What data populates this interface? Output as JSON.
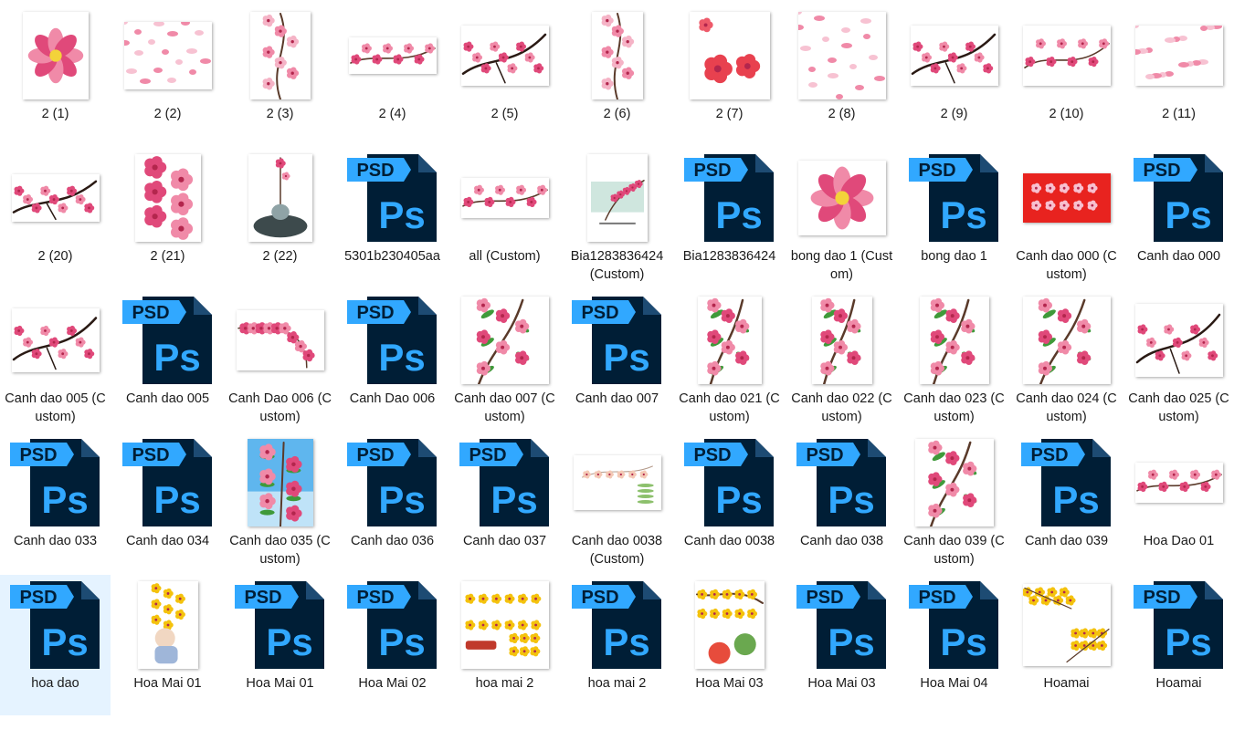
{
  "window": {
    "title": ""
  },
  "items": [
    {
      "name": "2 (1)",
      "kind": "img",
      "art": "flower-big",
      "bg": "#ffffff",
      "w": 72,
      "h": 96
    },
    {
      "name": "2 (2)",
      "kind": "img",
      "art": "petals",
      "bg": "#ffffff",
      "w": 96,
      "h": 74
    },
    {
      "name": "2 (3)",
      "kind": "img",
      "art": "branch-v",
      "bg": "#ffffff",
      "w": 66,
      "h": 96
    },
    {
      "name": "2 (4)",
      "kind": "img",
      "art": "branch-h",
      "bg": "#ffffff",
      "w": 96,
      "h": 40
    },
    {
      "name": "2 (5)",
      "kind": "img",
      "art": "branch-dark",
      "bg": "#ffffff",
      "w": 96,
      "h": 66
    },
    {
      "name": "2 (6)",
      "kind": "img",
      "art": "branch-v",
      "bg": "#ffffff",
      "w": 56,
      "h": 96
    },
    {
      "name": "2 (7)",
      "kind": "img",
      "art": "poppies",
      "bg": "#ffffff",
      "w": 88,
      "h": 96
    },
    {
      "name": "2 (8)",
      "kind": "img",
      "art": "petals",
      "bg": "#ffffff",
      "w": 96,
      "h": 96
    },
    {
      "name": "2 (9)",
      "kind": "img",
      "art": "branch-dark",
      "bg": "#ffffff",
      "w": 96,
      "h": 66
    },
    {
      "name": "2 (10)",
      "kind": "img",
      "art": "branch-h",
      "bg": "#ffffff",
      "w": 96,
      "h": 66
    },
    {
      "name": "2 (11)",
      "kind": "img",
      "art": "petals",
      "bg": "#ffffff",
      "w": 96,
      "h": 66
    },
    {
      "name": "2 (20)",
      "kind": "img",
      "art": "branch-dark",
      "bg": "#ffffff",
      "w": 96,
      "h": 52
    },
    {
      "name": "2 (21)",
      "kind": "img",
      "art": "flowers",
      "bg": "#ffffff",
      "w": 72,
      "h": 96
    },
    {
      "name": "2 (22)",
      "kind": "img",
      "art": "vase",
      "bg": "#ffffff",
      "w": 70,
      "h": 96
    },
    {
      "name": "5301b230405aa",
      "kind": "psd"
    },
    {
      "name": "all (Custom)",
      "kind": "img",
      "art": "branch-h",
      "bg": "#ffffff",
      "w": 96,
      "h": 44
    },
    {
      "name": "Bia1283836424 (Custom)",
      "kind": "img",
      "art": "card",
      "bg": "#ffffff",
      "w": 66,
      "h": 96
    },
    {
      "name": "Bia1283836424",
      "kind": "psd"
    },
    {
      "name": "bong dao 1 (Custom)",
      "kind": "img",
      "art": "flower-big",
      "bg": "#ffffff",
      "w": 96,
      "h": 82
    },
    {
      "name": "bong dao 1",
      "kind": "psd"
    },
    {
      "name": "Canh dao 000 (Custom)",
      "kind": "img",
      "art": "red-card",
      "bg": "#e8231f",
      "w": 96,
      "h": 54
    },
    {
      "name": "Canh dao 000",
      "kind": "psd"
    },
    {
      "name": "Canh dao 005 (Custom)",
      "kind": "img",
      "art": "branch-dark",
      "bg": "#ffffff",
      "w": 96,
      "h": 70
    },
    {
      "name": "Canh dao 005",
      "kind": "psd"
    },
    {
      "name": "Canh Dao 006 (Custom)",
      "kind": "img",
      "art": "garland",
      "bg": "#ffffff",
      "w": 96,
      "h": 66
    },
    {
      "name": "Canh Dao 006",
      "kind": "psd"
    },
    {
      "name": "Canh dao 007 (Custom)",
      "kind": "img",
      "art": "green-branch",
      "bg": "#ffffff",
      "w": 96,
      "h": 96
    },
    {
      "name": "Canh dao 007",
      "kind": "psd"
    },
    {
      "name": "Canh dao 021 (Custom)",
      "kind": "img",
      "art": "green-branch",
      "bg": "#ffffff",
      "w": 70,
      "h": 96
    },
    {
      "name": "Canh dao 022 (Custom)",
      "kind": "img",
      "art": "green-branch",
      "bg": "#ffffff",
      "w": 66,
      "h": 96
    },
    {
      "name": "Canh dao 023 (Custom)",
      "kind": "img",
      "art": "green-branch",
      "bg": "#ffffff",
      "w": 76,
      "h": 96
    },
    {
      "name": "Canh dao 024 (Custom)",
      "kind": "img",
      "art": "green-branch",
      "bg": "#ffffff",
      "w": 96,
      "h": 96
    },
    {
      "name": "Canh dao 025 (Custom)",
      "kind": "img",
      "art": "branch-dark",
      "bg": "#ffffff",
      "w": 96,
      "h": 80
    },
    {
      "name": "Canh dao 033",
      "kind": "psd"
    },
    {
      "name": "Canh dao 034",
      "kind": "psd"
    },
    {
      "name": "Canh dao 035 (Custom)",
      "kind": "img",
      "art": "sky-branch",
      "bg": "#4fa8e6",
      "w": 72,
      "h": 96
    },
    {
      "name": "Canh dao 036",
      "kind": "psd"
    },
    {
      "name": "Canh dao 037",
      "kind": "psd"
    },
    {
      "name": "Canh dao 0038 (Custom)",
      "kind": "img",
      "art": "pale-card",
      "bg": "#ffffff",
      "w": 96,
      "h": 60
    },
    {
      "name": "Canh dao 0038",
      "kind": "psd"
    },
    {
      "name": "Canh dao 038",
      "kind": "psd"
    },
    {
      "name": "Canh dao 039 (Custom)",
      "kind": "img",
      "art": "green-branch",
      "bg": "#ffffff",
      "w": 86,
      "h": 96
    },
    {
      "name": "Canh dao 039",
      "kind": "psd"
    },
    {
      "name": "Hoa Dao 01",
      "kind": "img",
      "art": "branch-h",
      "bg": "#ffffff",
      "w": 96,
      "h": 44
    },
    {
      "name": "hoa dao",
      "kind": "psd",
      "selected": true
    },
    {
      "name": "Hoa Mai 01",
      "kind": "img",
      "art": "mai-child",
      "bg": "#ffffff",
      "w": 66,
      "h": 96
    },
    {
      "name": "Hoa Mai 01",
      "kind": "psd"
    },
    {
      "name": "Hoa Mai 02",
      "kind": "psd"
    },
    {
      "name": "hoa mai 2",
      "kind": "img",
      "art": "mai-bonsai",
      "bg": "#ffffff",
      "w": 96,
      "h": 96
    },
    {
      "name": "hoa mai 2",
      "kind": "psd"
    },
    {
      "name": "Hoa Mai 03",
      "kind": "img",
      "art": "mai-fruit",
      "bg": "#ffffff",
      "w": 76,
      "h": 96
    },
    {
      "name": "Hoa Mai 03",
      "kind": "psd"
    },
    {
      "name": "Hoa Mai 04",
      "kind": "psd"
    },
    {
      "name": "Hoamai",
      "kind": "img",
      "art": "mai-corner",
      "bg": "#ffffff",
      "w": 96,
      "h": 90
    },
    {
      "name": "Hoamai",
      "kind": "psd"
    }
  ],
  "psd_icon": {
    "badge_text": "PSD",
    "logo_text": "Ps",
    "badge_color": "#31a8ff",
    "body_color": "#001e36",
    "logo_color": "#31a8ff"
  },
  "colors": {
    "selection_bg": "#e5f3ff",
    "blossom_pink": "#f08aa8",
    "blossom_deep": "#e0497a",
    "branch_brown": "#5a3a2a",
    "leaf_green": "#3f9a3a",
    "mai_yellow": "#f4c20d"
  }
}
